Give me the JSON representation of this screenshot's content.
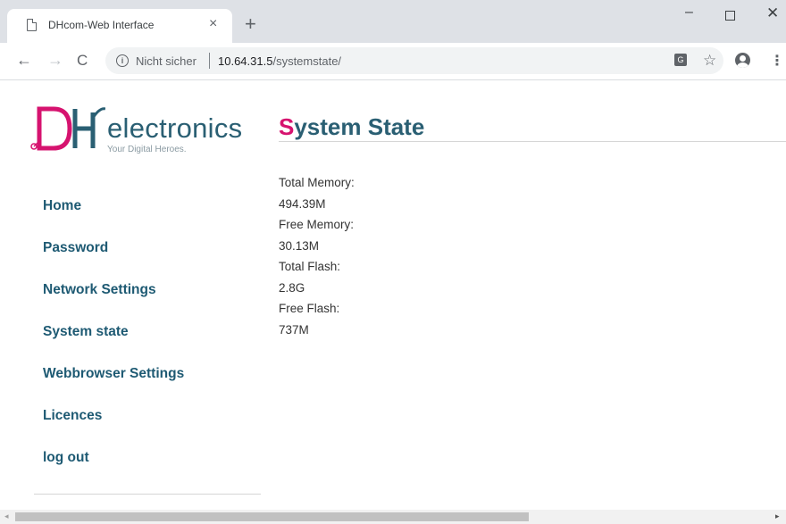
{
  "browser": {
    "tab_title": "DHcom-Web Interface",
    "tab_close": "×",
    "new_tab": "+",
    "win_minimize": "–",
    "win_close": "✕",
    "back": "←",
    "forward": "→",
    "reload": "C",
    "info": "i",
    "insecure_label": "Nicht sicher",
    "url_host": "10.64.31.5",
    "url_path": "/systemstate/",
    "star": "☆",
    "menu": "⋮",
    "translate": "G"
  },
  "logo": {
    "text": "electronics",
    "tagline": "Your Digital Heroes.",
    "colors": {
      "magenta": "#d6136f",
      "teal": "#2a5f73"
    }
  },
  "sidebar": {
    "items": [
      {
        "label": "Home"
      },
      {
        "label": "Password"
      },
      {
        "label": "Network Settings"
      },
      {
        "label": "System state"
      },
      {
        "label": "Webbrowser Settings"
      },
      {
        "label": "Licences"
      },
      {
        "label": "log out"
      }
    ]
  },
  "main": {
    "title_first": "S",
    "title_rest": "ystem State",
    "stats": [
      {
        "label": "Total Memory:",
        "value": "494.39M"
      },
      {
        "label": "Free Memory:",
        "value": "30.13M"
      },
      {
        "label": "Total Flash:",
        "value": "2.8G"
      },
      {
        "label": "Free Flash:",
        "value": "737M"
      }
    ]
  },
  "scrollbar": {
    "left_arrow": "◂",
    "right_arrow": "▸"
  }
}
